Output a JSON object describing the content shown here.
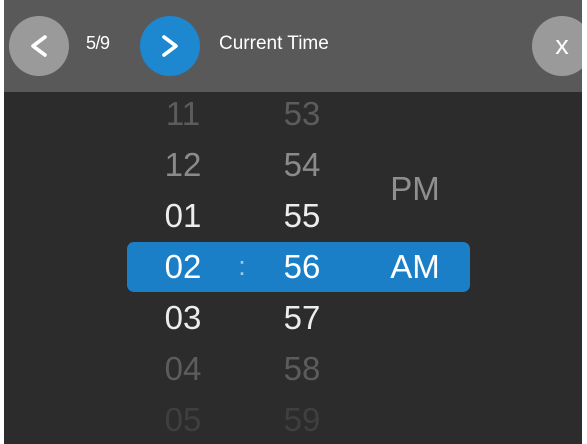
{
  "header": {
    "prev_label": "<",
    "page_counter": "5/9",
    "next_label": ">",
    "title": "Current Time",
    "close_label": "x"
  },
  "picker": {
    "hours": [
      "11",
      "12",
      "01",
      "02",
      "03",
      "04",
      "05"
    ],
    "minutes": [
      "53",
      "54",
      "55",
      "56",
      "57",
      "58",
      "59"
    ],
    "separator": ":",
    "period_options": [
      "PM",
      "AM"
    ],
    "selected": {
      "hour": "02",
      "minute": "56",
      "period": "AM"
    }
  },
  "colors": {
    "accent": "#1b7fc8",
    "header_bg": "#595959",
    "body_bg": "#2c2c2c",
    "secondary_button": "#9a9a9a"
  }
}
